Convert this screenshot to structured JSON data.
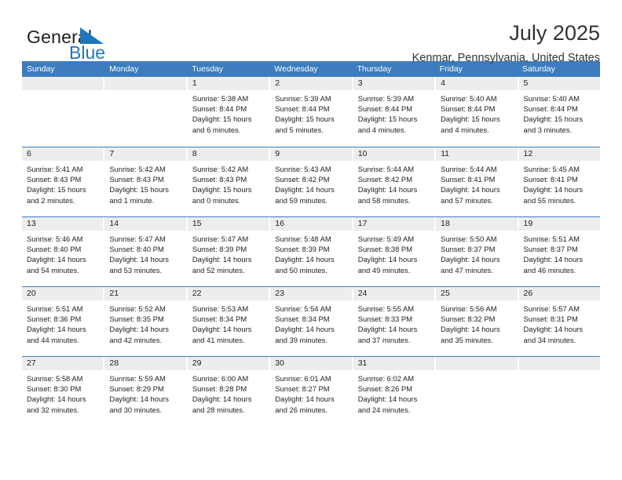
{
  "brand": {
    "name_part1": "General",
    "name_part2": "Blue",
    "mark_icon": "triangle-flag-icon",
    "accent_color": "#1f76bd"
  },
  "header": {
    "title": "July 2025",
    "subtitle": "Kenmar, Pennsylvania, United States"
  },
  "calendar": {
    "header_bg": "#3c7cbf",
    "daycell_header_bg": "#ededed",
    "weekdays": [
      "Sunday",
      "Monday",
      "Tuesday",
      "Wednesday",
      "Thursday",
      "Friday",
      "Saturday"
    ],
    "weeks": [
      [
        {
          "day": "",
          "empty": true,
          "sunrise": "",
          "sunset": "",
          "daylight": ""
        },
        {
          "day": "",
          "empty": true,
          "sunrise": "",
          "sunset": "",
          "daylight": ""
        },
        {
          "day": "1",
          "sunrise": "Sunrise: 5:38 AM",
          "sunset": "Sunset: 8:44 PM",
          "daylight": "Daylight: 15 hours and 6 minutes."
        },
        {
          "day": "2",
          "sunrise": "Sunrise: 5:39 AM",
          "sunset": "Sunset: 8:44 PM",
          "daylight": "Daylight: 15 hours and 5 minutes."
        },
        {
          "day": "3",
          "sunrise": "Sunrise: 5:39 AM",
          "sunset": "Sunset: 8:44 PM",
          "daylight": "Daylight: 15 hours and 4 minutes."
        },
        {
          "day": "4",
          "sunrise": "Sunrise: 5:40 AM",
          "sunset": "Sunset: 8:44 PM",
          "daylight": "Daylight: 15 hours and 4 minutes."
        },
        {
          "day": "5",
          "sunrise": "Sunrise: 5:40 AM",
          "sunset": "Sunset: 8:44 PM",
          "daylight": "Daylight: 15 hours and 3 minutes."
        }
      ],
      [
        {
          "day": "6",
          "sunrise": "Sunrise: 5:41 AM",
          "sunset": "Sunset: 8:43 PM",
          "daylight": "Daylight: 15 hours and 2 minutes."
        },
        {
          "day": "7",
          "sunrise": "Sunrise: 5:42 AM",
          "sunset": "Sunset: 8:43 PM",
          "daylight": "Daylight: 15 hours and 1 minute."
        },
        {
          "day": "8",
          "sunrise": "Sunrise: 5:42 AM",
          "sunset": "Sunset: 8:43 PM",
          "daylight": "Daylight: 15 hours and 0 minutes."
        },
        {
          "day": "9",
          "sunrise": "Sunrise: 5:43 AM",
          "sunset": "Sunset: 8:42 PM",
          "daylight": "Daylight: 14 hours and 59 minutes."
        },
        {
          "day": "10",
          "sunrise": "Sunrise: 5:44 AM",
          "sunset": "Sunset: 8:42 PM",
          "daylight": "Daylight: 14 hours and 58 minutes."
        },
        {
          "day": "11",
          "sunrise": "Sunrise: 5:44 AM",
          "sunset": "Sunset: 8:41 PM",
          "daylight": "Daylight: 14 hours and 57 minutes."
        },
        {
          "day": "12",
          "sunrise": "Sunrise: 5:45 AM",
          "sunset": "Sunset: 8:41 PM",
          "daylight": "Daylight: 14 hours and 55 minutes."
        }
      ],
      [
        {
          "day": "13",
          "sunrise": "Sunrise: 5:46 AM",
          "sunset": "Sunset: 8:40 PM",
          "daylight": "Daylight: 14 hours and 54 minutes."
        },
        {
          "day": "14",
          "sunrise": "Sunrise: 5:47 AM",
          "sunset": "Sunset: 8:40 PM",
          "daylight": "Daylight: 14 hours and 53 minutes."
        },
        {
          "day": "15",
          "sunrise": "Sunrise: 5:47 AM",
          "sunset": "Sunset: 8:39 PM",
          "daylight": "Daylight: 14 hours and 52 minutes."
        },
        {
          "day": "16",
          "sunrise": "Sunrise: 5:48 AM",
          "sunset": "Sunset: 8:39 PM",
          "daylight": "Daylight: 14 hours and 50 minutes."
        },
        {
          "day": "17",
          "sunrise": "Sunrise: 5:49 AM",
          "sunset": "Sunset: 8:38 PM",
          "daylight": "Daylight: 14 hours and 49 minutes."
        },
        {
          "day": "18",
          "sunrise": "Sunrise: 5:50 AM",
          "sunset": "Sunset: 8:37 PM",
          "daylight": "Daylight: 14 hours and 47 minutes."
        },
        {
          "day": "19",
          "sunrise": "Sunrise: 5:51 AM",
          "sunset": "Sunset: 8:37 PM",
          "daylight": "Daylight: 14 hours and 46 minutes."
        }
      ],
      [
        {
          "day": "20",
          "sunrise": "Sunrise: 5:51 AM",
          "sunset": "Sunset: 8:36 PM",
          "daylight": "Daylight: 14 hours and 44 minutes."
        },
        {
          "day": "21",
          "sunrise": "Sunrise: 5:52 AM",
          "sunset": "Sunset: 8:35 PM",
          "daylight": "Daylight: 14 hours and 42 minutes."
        },
        {
          "day": "22",
          "sunrise": "Sunrise: 5:53 AM",
          "sunset": "Sunset: 8:34 PM",
          "daylight": "Daylight: 14 hours and 41 minutes."
        },
        {
          "day": "23",
          "sunrise": "Sunrise: 5:54 AM",
          "sunset": "Sunset: 8:34 PM",
          "daylight": "Daylight: 14 hours and 39 minutes."
        },
        {
          "day": "24",
          "sunrise": "Sunrise: 5:55 AM",
          "sunset": "Sunset: 8:33 PM",
          "daylight": "Daylight: 14 hours and 37 minutes."
        },
        {
          "day": "25",
          "sunrise": "Sunrise: 5:56 AM",
          "sunset": "Sunset: 8:32 PM",
          "daylight": "Daylight: 14 hours and 35 minutes."
        },
        {
          "day": "26",
          "sunrise": "Sunrise: 5:57 AM",
          "sunset": "Sunset: 8:31 PM",
          "daylight": "Daylight: 14 hours and 34 minutes."
        }
      ],
      [
        {
          "day": "27",
          "sunrise": "Sunrise: 5:58 AM",
          "sunset": "Sunset: 8:30 PM",
          "daylight": "Daylight: 14 hours and 32 minutes."
        },
        {
          "day": "28",
          "sunrise": "Sunrise: 5:59 AM",
          "sunset": "Sunset: 8:29 PM",
          "daylight": "Daylight: 14 hours and 30 minutes."
        },
        {
          "day": "29",
          "sunrise": "Sunrise: 6:00 AM",
          "sunset": "Sunset: 8:28 PM",
          "daylight": "Daylight: 14 hours and 28 minutes."
        },
        {
          "day": "30",
          "sunrise": "Sunrise: 6:01 AM",
          "sunset": "Sunset: 8:27 PM",
          "daylight": "Daylight: 14 hours and 26 minutes."
        },
        {
          "day": "31",
          "sunrise": "Sunrise: 6:02 AM",
          "sunset": "Sunset: 8:26 PM",
          "daylight": "Daylight: 14 hours and 24 minutes."
        },
        {
          "day": "",
          "empty": true,
          "sunrise": "",
          "sunset": "",
          "daylight": ""
        },
        {
          "day": "",
          "empty": true,
          "sunrise": "",
          "sunset": "",
          "daylight": ""
        }
      ]
    ]
  }
}
